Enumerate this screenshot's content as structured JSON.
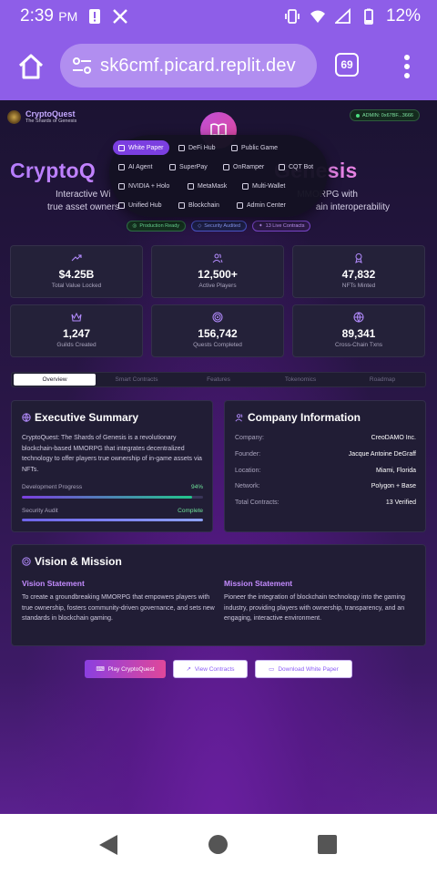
{
  "status_bar": {
    "time": "2:39",
    "ampm": "PM",
    "battery": "12%"
  },
  "browser": {
    "url": "sk6cmf.picard.replit.dev",
    "tab_count": "69"
  },
  "site": {
    "brand_name": "CryptoQuest",
    "brand_tagline": "The Shards of Genesis",
    "admin_label": "ADMIN: 0x67BF...3666"
  },
  "hero": {
    "title_left": "CryptoQ",
    "title_right": "Genesis",
    "subtitle_line1_left": "Interactive Wi",
    "subtitle_line1_right": "MMORPG with",
    "subtitle_line2_left": "true asset owners",
    "subtitle_line2_right": "ain interoperability",
    "badges": [
      "Production Ready",
      "Security Audited",
      "13 Live Contracts"
    ]
  },
  "nav_menu": {
    "items": [
      "White Paper",
      "DeFi Hub",
      "Public Game",
      "AI Agent",
      "SuperPay",
      "OnRamper",
      "CQT Bot",
      "NVIDIA + Holo",
      "MetaMask",
      "Multi-Wallet",
      "Unified Hub",
      "Blockchain",
      "Admin Center"
    ],
    "active": "White Paper"
  },
  "stats": [
    {
      "value": "$4.25B",
      "label": "Total Value Locked",
      "icon": "trending-up-icon"
    },
    {
      "value": "12,500+",
      "label": "Active Players",
      "icon": "users-icon"
    },
    {
      "value": "47,832",
      "label": "NFTs Minted",
      "icon": "award-icon"
    },
    {
      "value": "1,247",
      "label": "Guilds Created",
      "icon": "crown-icon"
    },
    {
      "value": "156,742",
      "label": "Quests Completed",
      "icon": "target-icon"
    },
    {
      "value": "89,341",
      "label": "Cross-Chain Txns",
      "icon": "globe-icon"
    }
  ],
  "tabs": [
    "Overview",
    "Smart Contracts",
    "Features",
    "Tokenomics",
    "Roadmap"
  ],
  "executive_summary": {
    "title": "Executive Summary",
    "body": "CryptoQuest: The Shards of Genesis is a revolutionary blockchain-based MMORPG that integrates decentralized technology to offer players true ownership of in-game assets via NFTs.",
    "progress": [
      {
        "label": "Development Progress",
        "value": "94%",
        "fraction": 0.94
      },
      {
        "label": "Security Audit",
        "value": "Complete",
        "fraction": 1.0
      }
    ]
  },
  "company": {
    "title": "Company Information",
    "rows": [
      {
        "key": "Company:",
        "value": "CreoDAMO Inc."
      },
      {
        "key": "Founder:",
        "value": "Jacque Antoine DeGraff"
      },
      {
        "key": "Location:",
        "value": "Miami, Florida"
      },
      {
        "key": "Network:",
        "value": "Polygon + Base"
      },
      {
        "key": "Total Contracts:",
        "value": "13 Verified"
      }
    ]
  },
  "vision": {
    "title": "Vision & Mission",
    "vision_heading": "Vision Statement",
    "vision_text": "To create a groundbreaking MMORPG that empowers players with true ownership, fosters community-driven governance, and sets new standards in blockchain gaming.",
    "mission_heading": "Mission Statement",
    "mission_text": "Pioneer the integration of blockchain technology into the gaming industry, providing players with ownership, transparency, and an engaging, interactive environment."
  },
  "actions": {
    "play": "Play CryptoQuest",
    "contracts": "View Contracts",
    "whitepaper": "Download White Paper"
  },
  "colors": {
    "accent": "#8e5ee8",
    "brand_purple": "#7b3fe0",
    "pink": "#e0479a",
    "success": "#6fe39a"
  }
}
